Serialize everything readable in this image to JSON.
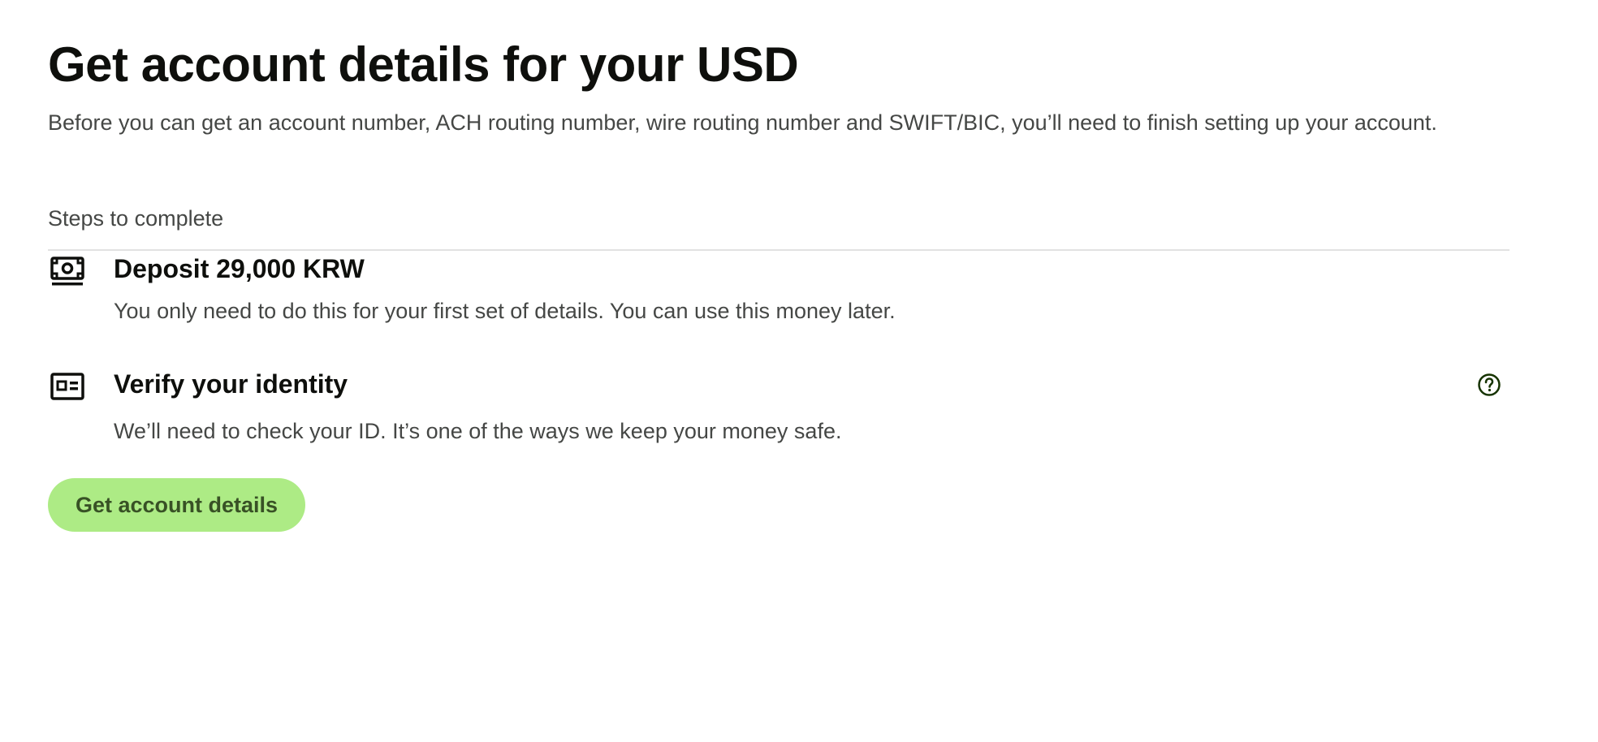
{
  "header": {
    "title": "Get account details for your USD",
    "subtitle": "Before you can get an account number, ACH routing number, wire routing number and SWIFT/BIC, you’ll need to finish setting up your account."
  },
  "steps_section": {
    "heading": "Steps to complete",
    "steps": [
      {
        "icon": "cash-icon",
        "title": "Deposit 29,000 KRW",
        "description": "You only need to do this for your first set of details. You can use this money later."
      },
      {
        "icon": "id-card-icon",
        "title": "Verify your identity",
        "description": "We’ll need to check your ID. It’s one of the ways we keep your money safe.",
        "help_icon": "question-circle-icon"
      }
    ]
  },
  "actions": {
    "primary_label": "Get account details"
  },
  "colors": {
    "accent": "#9fe870",
    "accent_text": "#163300",
    "title_text": "#0e0f0c",
    "body_text": "#454745",
    "divider": "#e2e2e2"
  }
}
